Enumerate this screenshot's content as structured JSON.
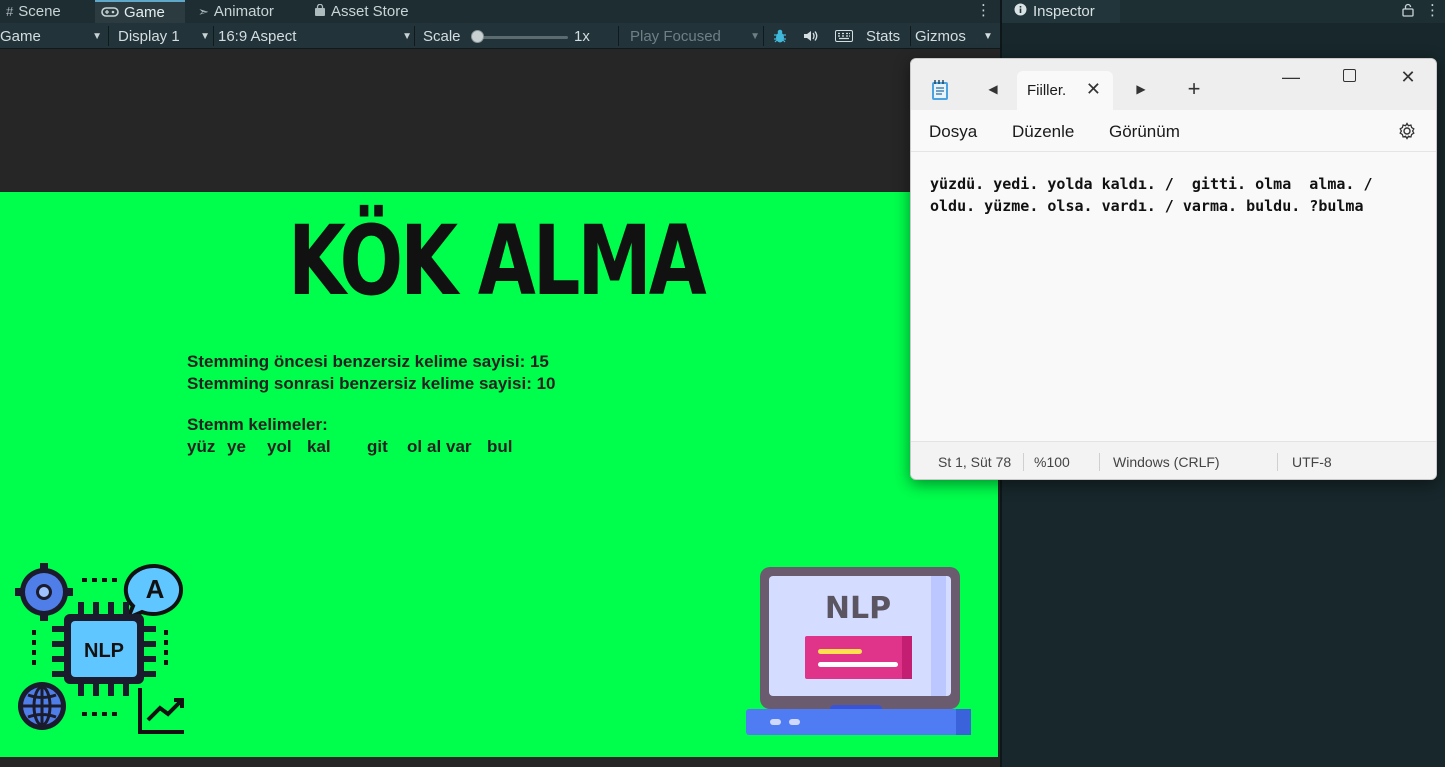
{
  "editor": {
    "tabs": [
      {
        "label": "Scene",
        "icon": "grid-icon"
      },
      {
        "label": "Game",
        "icon": "gamepad-icon"
      },
      {
        "label": "Animator",
        "icon": "animator-icon"
      },
      {
        "label": "Asset Store",
        "icon": "bag-icon"
      }
    ],
    "toolbar": {
      "view_select": "Game",
      "display_select": "Display 1",
      "aspect_select": "16:9 Aspect",
      "scale_label": "Scale",
      "scale_value": "1x",
      "scale_level": 0.0,
      "play_mode": "Play Focused",
      "stats_label": "Stats",
      "gizmos_label": "Gizmos"
    },
    "inspector_tab": "Inspector"
  },
  "game": {
    "title": "KÖK ALMA",
    "line1": "Stemming öncesi benzersiz kelime sayisi: 15",
    "line2": "Stemming sonrasi benzersiz kelime sayisi: 10",
    "stems_label": "Stemm kelimeler:",
    "stems": [
      "yüz",
      "ye",
      "yol",
      "kal",
      "git",
      "ol",
      "al",
      "var",
      "bul"
    ],
    "nlp_left_text": "NLP",
    "nlp_left_letter": "A",
    "nlp_laptop_text": "NLP",
    "colors": {
      "background": "#00ff4c",
      "text": "#222222"
    }
  },
  "notepad": {
    "tab_title": "Fiiller.",
    "menu": [
      "Dosya",
      "Düzenle",
      "Görünüm"
    ],
    "content_line1": "yüzdü. yedi. yolda kaldı. /  gitti. olma  alma. /",
    "content_line2": "oldu. yüzme. olsa. vardı. / varma. buldu. ?bulma",
    "status": {
      "position": "St 1, Süt 78",
      "zoom": "%100",
      "line_ending": "Windows (CRLF)",
      "encoding": "UTF-8"
    }
  }
}
